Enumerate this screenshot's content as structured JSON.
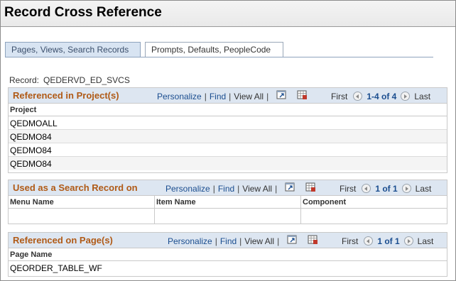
{
  "page": {
    "title": "Record Cross Reference"
  },
  "tabs": [
    {
      "label": "Pages, Views, Search Records",
      "active": true
    },
    {
      "label": "Prompts, Defaults, PeopleCode",
      "active": false
    }
  ],
  "record": {
    "label": "Record:",
    "value": "QEDERVD_ED_SVCS"
  },
  "nav": {
    "personalize": "Personalize",
    "find": "Find",
    "sep": "|",
    "view_all": "View All",
    "first": "First",
    "last": "Last"
  },
  "grid_projects": {
    "title": "Referenced in Project(s)",
    "range": "1-4 of 4",
    "columns": [
      "Project"
    ],
    "rows": [
      "QEDMOALL",
      "QEDMO84",
      "QEDMO84",
      "QEDMO84"
    ]
  },
  "grid_search": {
    "title": "Used as a Search Record on",
    "range": "1 of 1",
    "columns": [
      "Menu Name",
      "Item Name",
      "Component"
    ],
    "rows": [
      [
        "",
        "",
        ""
      ]
    ]
  },
  "grid_pages": {
    "title": "Referenced on Page(s)",
    "range": "1 of 1",
    "columns": [
      "Page Name"
    ],
    "rows": [
      "QEORDER_TABLE_WF"
    ]
  },
  "colors": {
    "accent_title": "#b05a16",
    "link": "#1a4d8f",
    "header_bg": "#dde6f1"
  },
  "icons": [
    "zoom-icon",
    "download-grid-icon",
    "prev-arrow-icon",
    "next-arrow-icon"
  ]
}
